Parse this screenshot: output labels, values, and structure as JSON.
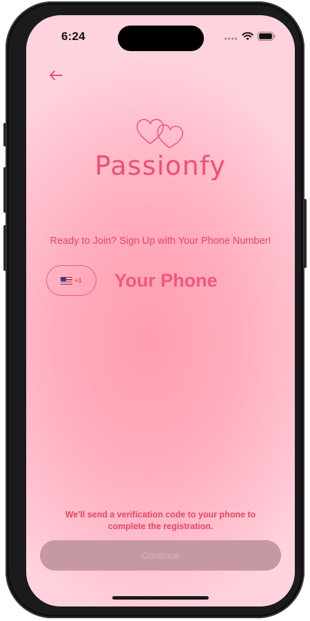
{
  "status_bar": {
    "time": "6:24",
    "icons": [
      "signal-dots-icon",
      "wifi-icon",
      "battery-icon"
    ]
  },
  "nav": {
    "back_icon": "arrow-left-icon"
  },
  "brand": {
    "logo_icon": "double-heart-icon",
    "name": "Passionfy"
  },
  "signup": {
    "tagline": "Ready to Join? Sign Up with Your Phone Number!",
    "country": {
      "flag_icon": "us-flag-icon",
      "dial_code": "+1"
    },
    "phone_input": {
      "value": "",
      "placeholder": "Your Phone"
    },
    "helper_text": "We'll send a verification code to your phone to complete the registration.",
    "continue_label": "Continue"
  },
  "colors": {
    "accent": "#ee4f70",
    "button_disabled": "#c698a3",
    "background_center": "#ff9db0",
    "background_edge": "#ffd3dd"
  }
}
